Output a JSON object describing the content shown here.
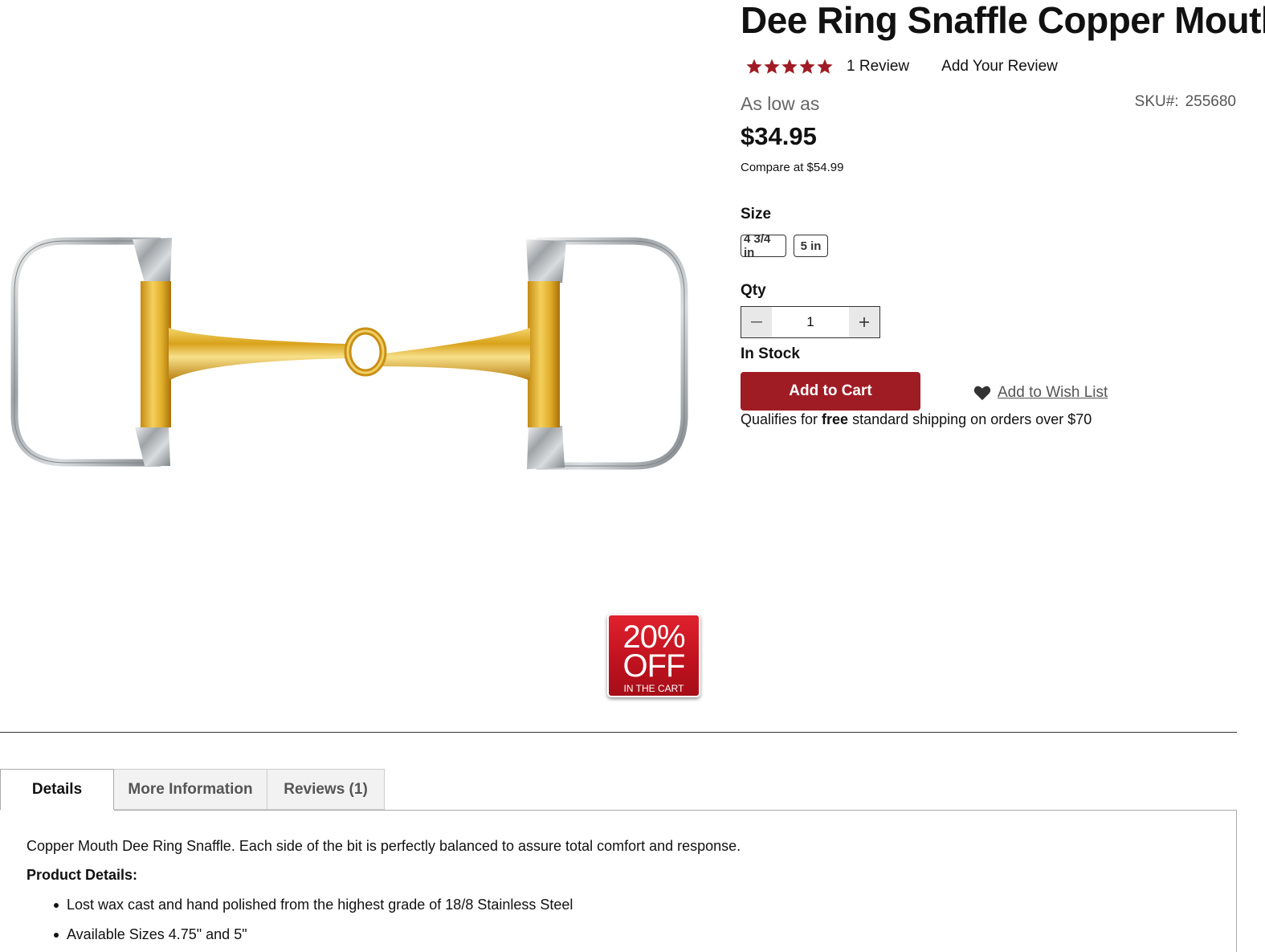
{
  "product": {
    "title": "Dee Ring Snaffle Copper Mouth",
    "rating": {
      "stars": 5,
      "max_stars": 5,
      "review_count": "1",
      "review_label": "Review",
      "add_review": "Add Your Review"
    },
    "as_low_as": "As low as",
    "price": "$34.95",
    "compare_at": "Compare at $54.99",
    "sku_label": "SKU#:",
    "sku_value": "255680",
    "size_label": "Size",
    "sizes": [
      "4 3/4 in",
      "5 in"
    ],
    "qty_label": "Qty",
    "qty_value": "1",
    "qty_minus": "−",
    "qty_plus": "+",
    "stock": "In Stock",
    "add_to_cart": "Add to Cart",
    "wishlist": "Add to Wish List",
    "shipping": {
      "prefix": "Qualifies for ",
      "bold": "free",
      "suffix": " standard shipping on orders over $70"
    }
  },
  "promo": {
    "percent": "20%",
    "off": "OFF",
    "sub": "IN THE CART"
  },
  "colors": {
    "brand_red": "#a01c24",
    "star_red": "#a01c24",
    "badge_red": "#c1121f"
  },
  "tabs": [
    {
      "label": "Details",
      "active": true
    },
    {
      "label": "More Information",
      "active": false
    },
    {
      "label": "Reviews (1)",
      "active": false
    }
  ],
  "details": {
    "description": "Copper Mouth Dee Ring Snaffle. Each side of the bit is perfectly balanced to assure total comfort and response.",
    "heading": "Product Details:",
    "bullets": [
      "Lost wax cast and hand polished from the highest grade of 18/8 Stainless Steel",
      "Available Sizes 4.75\" and 5\""
    ]
  },
  "icons": {
    "star": "star-icon",
    "heart": "heart-icon",
    "minus": "minus-icon",
    "plus": "plus-icon"
  }
}
